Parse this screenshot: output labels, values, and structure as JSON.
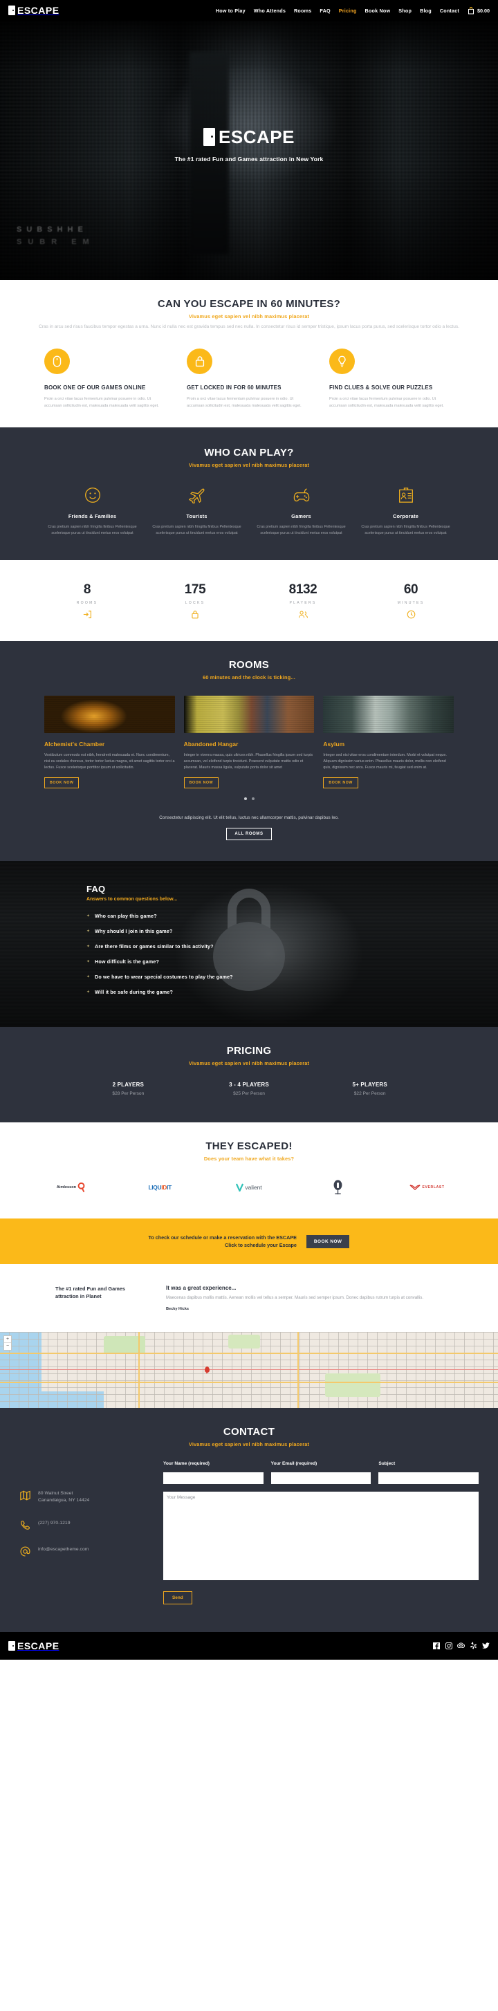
{
  "topnav": {
    "brand": "ESCAPE",
    "items": [
      {
        "label": "How to Play",
        "active": false
      },
      {
        "label": "Who Attends",
        "active": false
      },
      {
        "label": "Rooms",
        "active": false
      },
      {
        "label": "FAQ",
        "active": false
      },
      {
        "label": "Pricing",
        "active": true
      },
      {
        "label": "Book Now",
        "active": false
      },
      {
        "label": "Shop",
        "active": false
      },
      {
        "label": "Blog",
        "active": false
      },
      {
        "label": "Contact",
        "active": false
      }
    ],
    "cart_amount": "$0.00",
    "accent_color": "#f5a623"
  },
  "hero": {
    "title": "ESCAPE",
    "subtitle": "The #1 rated Fun and Games attraction in New York",
    "ghost_line_1": "SUBSHHE",
    "ghost_line_2": "SUBR  EM"
  },
  "intro": {
    "heading": "CAN YOU ESCAPE IN 60 MINUTES?",
    "subheading": "Vivamus eget sapien vel nibh maximus placerat",
    "body": "Cras in arcu sed risus faucibus tempor egestas a urna. Nunc id nulla nec est gravida tempus sed nec nulla. In consectetur risus id semper tristique, ipsum lacus porta purus, sed scelerisque tortor odio a lectus."
  },
  "features": [
    {
      "icon": "mouse-icon",
      "title": "BOOK ONE OF OUR GAMES ONLINE",
      "text": "Proin a orci vitae lacus fermentum pulvinar posuere in odio. Ut accumsan sollicitudin est, malesuada malesuada velit sagittis eget."
    },
    {
      "icon": "lock-icon",
      "title": "GET LOCKED IN FOR 60 MINUTES",
      "text": "Proin a orci vitae lacus fermentum pulvinar posuere in odio. Ut accumsan sollicitudin est, malesuada malesuada velit sagittis eget."
    },
    {
      "icon": "lightbulb-icon",
      "title": "FIND CLUES & SOLVE OUR PUZZLES",
      "text": "Proin a orci vitae lacus fermentum pulvinar posuere in odio. Ut accumsan sollicitudin est, malesuada malesuada velit sagittis eget."
    }
  ],
  "whocanplay": {
    "heading": "WHO CAN PLAY?",
    "subheading": "Vivamus eget sapien vel nibh maximus placerat",
    "items": [
      {
        "icon": "smiley-icon",
        "title": "Friends & Families",
        "text": "Cras pretium sapien nibh fringilla finibus Pellentesque scelerisque purus ut tincidunt metus eros volutpat"
      },
      {
        "icon": "airplane-icon",
        "title": "Tourists",
        "text": "Cras pretium sapien nibh fringilla finibus Pellentesque scelerisque purus ut tincidunt metus eros volutpat"
      },
      {
        "icon": "gamepad-icon",
        "title": "Gamers",
        "text": "Cras pretium sapien nibh fringilla finibus Pellentesque scelerisque purus ut tincidunt metus eros volutpat"
      },
      {
        "icon": "id-badge-icon",
        "title": "Corporate",
        "text": "Cras pretium sapien nibh fringilla finibus Pellentesque scelerisque purus ut tincidunt metus eros volutpat"
      }
    ]
  },
  "stats": [
    {
      "number": "8",
      "label": "ROOMS",
      "icon": "exit-door-icon"
    },
    {
      "number": "175",
      "label": "LOCKS",
      "icon": "padlock-icon"
    },
    {
      "number": "8132",
      "label": "PLAYERS",
      "icon": "people-icon"
    },
    {
      "number": "60",
      "label": "MINUTES",
      "icon": "clock-icon"
    }
  ],
  "rooms": {
    "heading": "ROOMS",
    "subheading": "60 minutes and the clock is ticking...",
    "items": [
      {
        "title": "Alchemist's Chamber",
        "text": "Vestibulum commodo est nibh, hendrerit malesuada et. Nunc condimentum, nisi eu sodales rhoncus, tortor tortor luctus magna, sit amet sagittis tortor orci a lectus. Fusce scelerisque porttitor ipsum ut sollicitudin.",
        "button": "BOOK NOW"
      },
      {
        "title": "Abandoned Hangar",
        "text": "Integer in viverra massa, quis ultrices nibh. Phasellus fringilla ipsum sed turpis accumsan, vel eleifend turpis tincidunt. Praesent vulputate mattis odio et placerat. Mauris massa ligula, vulputate porta dolor sit amet",
        "button": "BOOK NOW"
      },
      {
        "title": "Asylum",
        "text": "Integer sed nisi vitae eros condimentum interdum. Morbi et volutpat neque. Aliquam dignissim varius enim. Phasellus mauris dolor, mollis non eleifend quis, dignissim nec arcu. Fusce mauris mi, feugiat sed enim at.",
        "button": "BOOK NOW"
      }
    ],
    "footer_text": "Consectetur adipiscing elit. Ut elit tellus, luctus nec ullamcorper mattis, pulvinar dapibus leo.",
    "all_rooms_button": "ALL ROOMS"
  },
  "faq": {
    "heading": "FAQ",
    "subheading": "Answers to common questions below...",
    "questions": [
      "Who can play this game?",
      "Why should I join in this game?",
      "Are there films or games similar to this activity?",
      "How difficult is the game?",
      "Do we have to wear special costumes to play the game?",
      "Will it be safe during the game?"
    ]
  },
  "pricing": {
    "heading": "PRICING",
    "subheading": "Vivamus eget sapien vel nibh maximus placerat",
    "tiers": [
      {
        "title": "2 PLAYERS",
        "price": "$28 Per Person"
      },
      {
        "title": "3 - 4 PLAYERS",
        "price": "$25 Per Person"
      },
      {
        "title": "5+ PLAYERS",
        "price": "$22 Per Person"
      }
    ]
  },
  "escaped": {
    "heading": "THEY ESCAPED!",
    "subheading": "Does your team have what it takes?",
    "logos": [
      {
        "name": "Aimlesson",
        "type": "aimlesson-logo"
      },
      {
        "name": "LIQUIDIT",
        "type": "liquidit-logo"
      },
      {
        "name": "valient",
        "type": "valient-logo"
      },
      {
        "name": "LIGHTHOUSE",
        "type": "lighthouse-logo"
      },
      {
        "name": "EVERLAST",
        "type": "everlast-logo"
      }
    ]
  },
  "cta": {
    "line1": "To check our schedule or make a reservation with the ESCAPE",
    "line2": "Click to schedule your Escape",
    "button": "BOOK NOW"
  },
  "testimonial": {
    "left": "The #1 rated Fun and Games attraction in Planet",
    "title": "It was a great experience...",
    "text": "Maecenas dapibus mollis mattis. Aenean mollis vel tellus a semper. Mauris sed semper ipsum. Donec dapibus rutrum turpis at convallis.",
    "author": "Becky Hicks"
  },
  "contact": {
    "heading": "CONTACT",
    "subheading": "Vivamus eget sapien vel nibh maximus placerat",
    "address_line1": "80 Walnut Street",
    "address_line2": "Canandaigua, NY 14424",
    "phone": "(227) 970-1219",
    "email": "info@escapetheme.com",
    "name_label": "Your Name (required)",
    "email_label": "Your Email (required)",
    "subject_label": "Subject",
    "name_value": "",
    "email_value": "",
    "subject_value": "",
    "message_placeholder": "Your Message",
    "message_value": "",
    "send_button": "Send"
  },
  "footer": {
    "brand": "ESCAPE",
    "social": [
      "facebook-icon",
      "instagram-icon",
      "tripadvisor-icon",
      "yelp-icon",
      "twitter-icon"
    ]
  }
}
